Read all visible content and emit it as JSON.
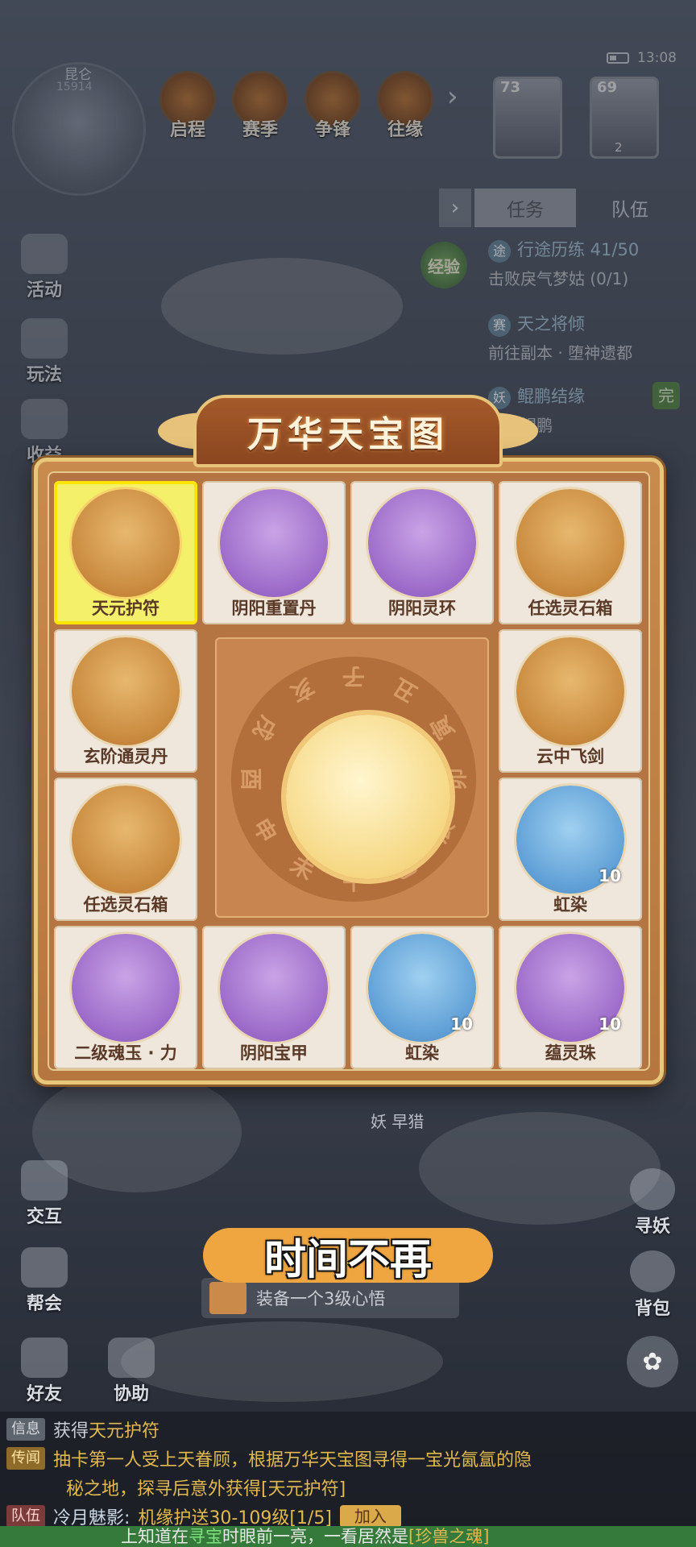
{
  "status": {
    "time": "13:08"
  },
  "minimap": {
    "name": "昆仑",
    "coords": "15914"
  },
  "top_buttons": [
    {
      "label": "启程"
    },
    {
      "label": "赛季"
    },
    {
      "label": "争锋"
    },
    {
      "label": "往缘"
    }
  ],
  "avatars": [
    {
      "level": "73"
    },
    {
      "level": "69",
      "count": "2"
    }
  ],
  "left_menu": [
    {
      "label": "活动"
    },
    {
      "label": "玩法"
    },
    {
      "label": "收益"
    }
  ],
  "task_panel": {
    "tabs": [
      "任务",
      "队伍"
    ],
    "exp_label": "经验",
    "tasks": [
      {
        "badge": "途",
        "title": "行途历练 41/50",
        "sub": "击败戾气梦姑 (0/1)"
      },
      {
        "badge": "赛",
        "title": "天之将倾",
        "sub": "前往副本 · 堕神遗都"
      },
      {
        "badge": "妖",
        "title": "鲲鹏结缘",
        "sub": "找寻鲲鹏",
        "status": "完"
      }
    ]
  },
  "treasure_map": {
    "title": "万华天宝图",
    "items": [
      {
        "label": "天元护符",
        "style": "gold",
        "selected": true
      },
      {
        "label": "阴阳重置丹",
        "style": "purple"
      },
      {
        "label": "阴阳灵环",
        "style": "purple"
      },
      {
        "label": "任选灵石箱",
        "style": "gold"
      },
      {
        "label": "玄阶通灵丹",
        "style": "gold"
      },
      {
        "label": "云中飞剑",
        "style": "gold"
      },
      {
        "label": "任选灵石箱",
        "style": "gold"
      },
      {
        "label": "虹染",
        "style": "blue",
        "qty": "10"
      },
      {
        "label": "二级魂玉 · 力",
        "style": "purple"
      },
      {
        "label": "阴阳宝甲",
        "style": "purple"
      },
      {
        "label": "虹染",
        "style": "blue",
        "qty": "10"
      },
      {
        "label": "蕴灵珠",
        "style": "purple",
        "qty": "10"
      }
    ],
    "wheel_marks": [
      "子",
      "丑",
      "寅",
      "卯",
      "辰",
      "巳",
      "午",
      "未",
      "申",
      "酉",
      "戌",
      "亥"
    ]
  },
  "behind_label": "妖 早猎",
  "subtitle": "时间不再",
  "quest_tip": "装备一个3级心悟",
  "left_bottom_menu": [
    {
      "label": "交互"
    },
    {
      "label": "帮会"
    },
    {
      "label": "好友"
    },
    {
      "label": "协助"
    }
  ],
  "right_menu": [
    {
      "label": "寻妖"
    },
    {
      "label": "背包"
    }
  ],
  "chat": {
    "line1": {
      "channel": "信息",
      "text_a": "获得",
      "text_b": "天元护符"
    },
    "line2": {
      "channel": "传闻",
      "text_a": "抽卡第一人",
      "text_b": "受上天眷顾，根据万华天宝图寻得一宝光氤氲的隐"
    },
    "line3": {
      "text": "秘之地，探寻后意外获得[天元护符]"
    },
    "line4": {
      "channel": "队伍",
      "name": "冷月魅影:",
      "text": "机缘护送30-109级[1/5]",
      "join": "加入"
    },
    "marquee_a": "上知道在",
    "marquee_b": "寻宝",
    "marquee_c": "时眼前一亮，一看居然是",
    "marquee_d": "[珍兽之魂]"
  }
}
